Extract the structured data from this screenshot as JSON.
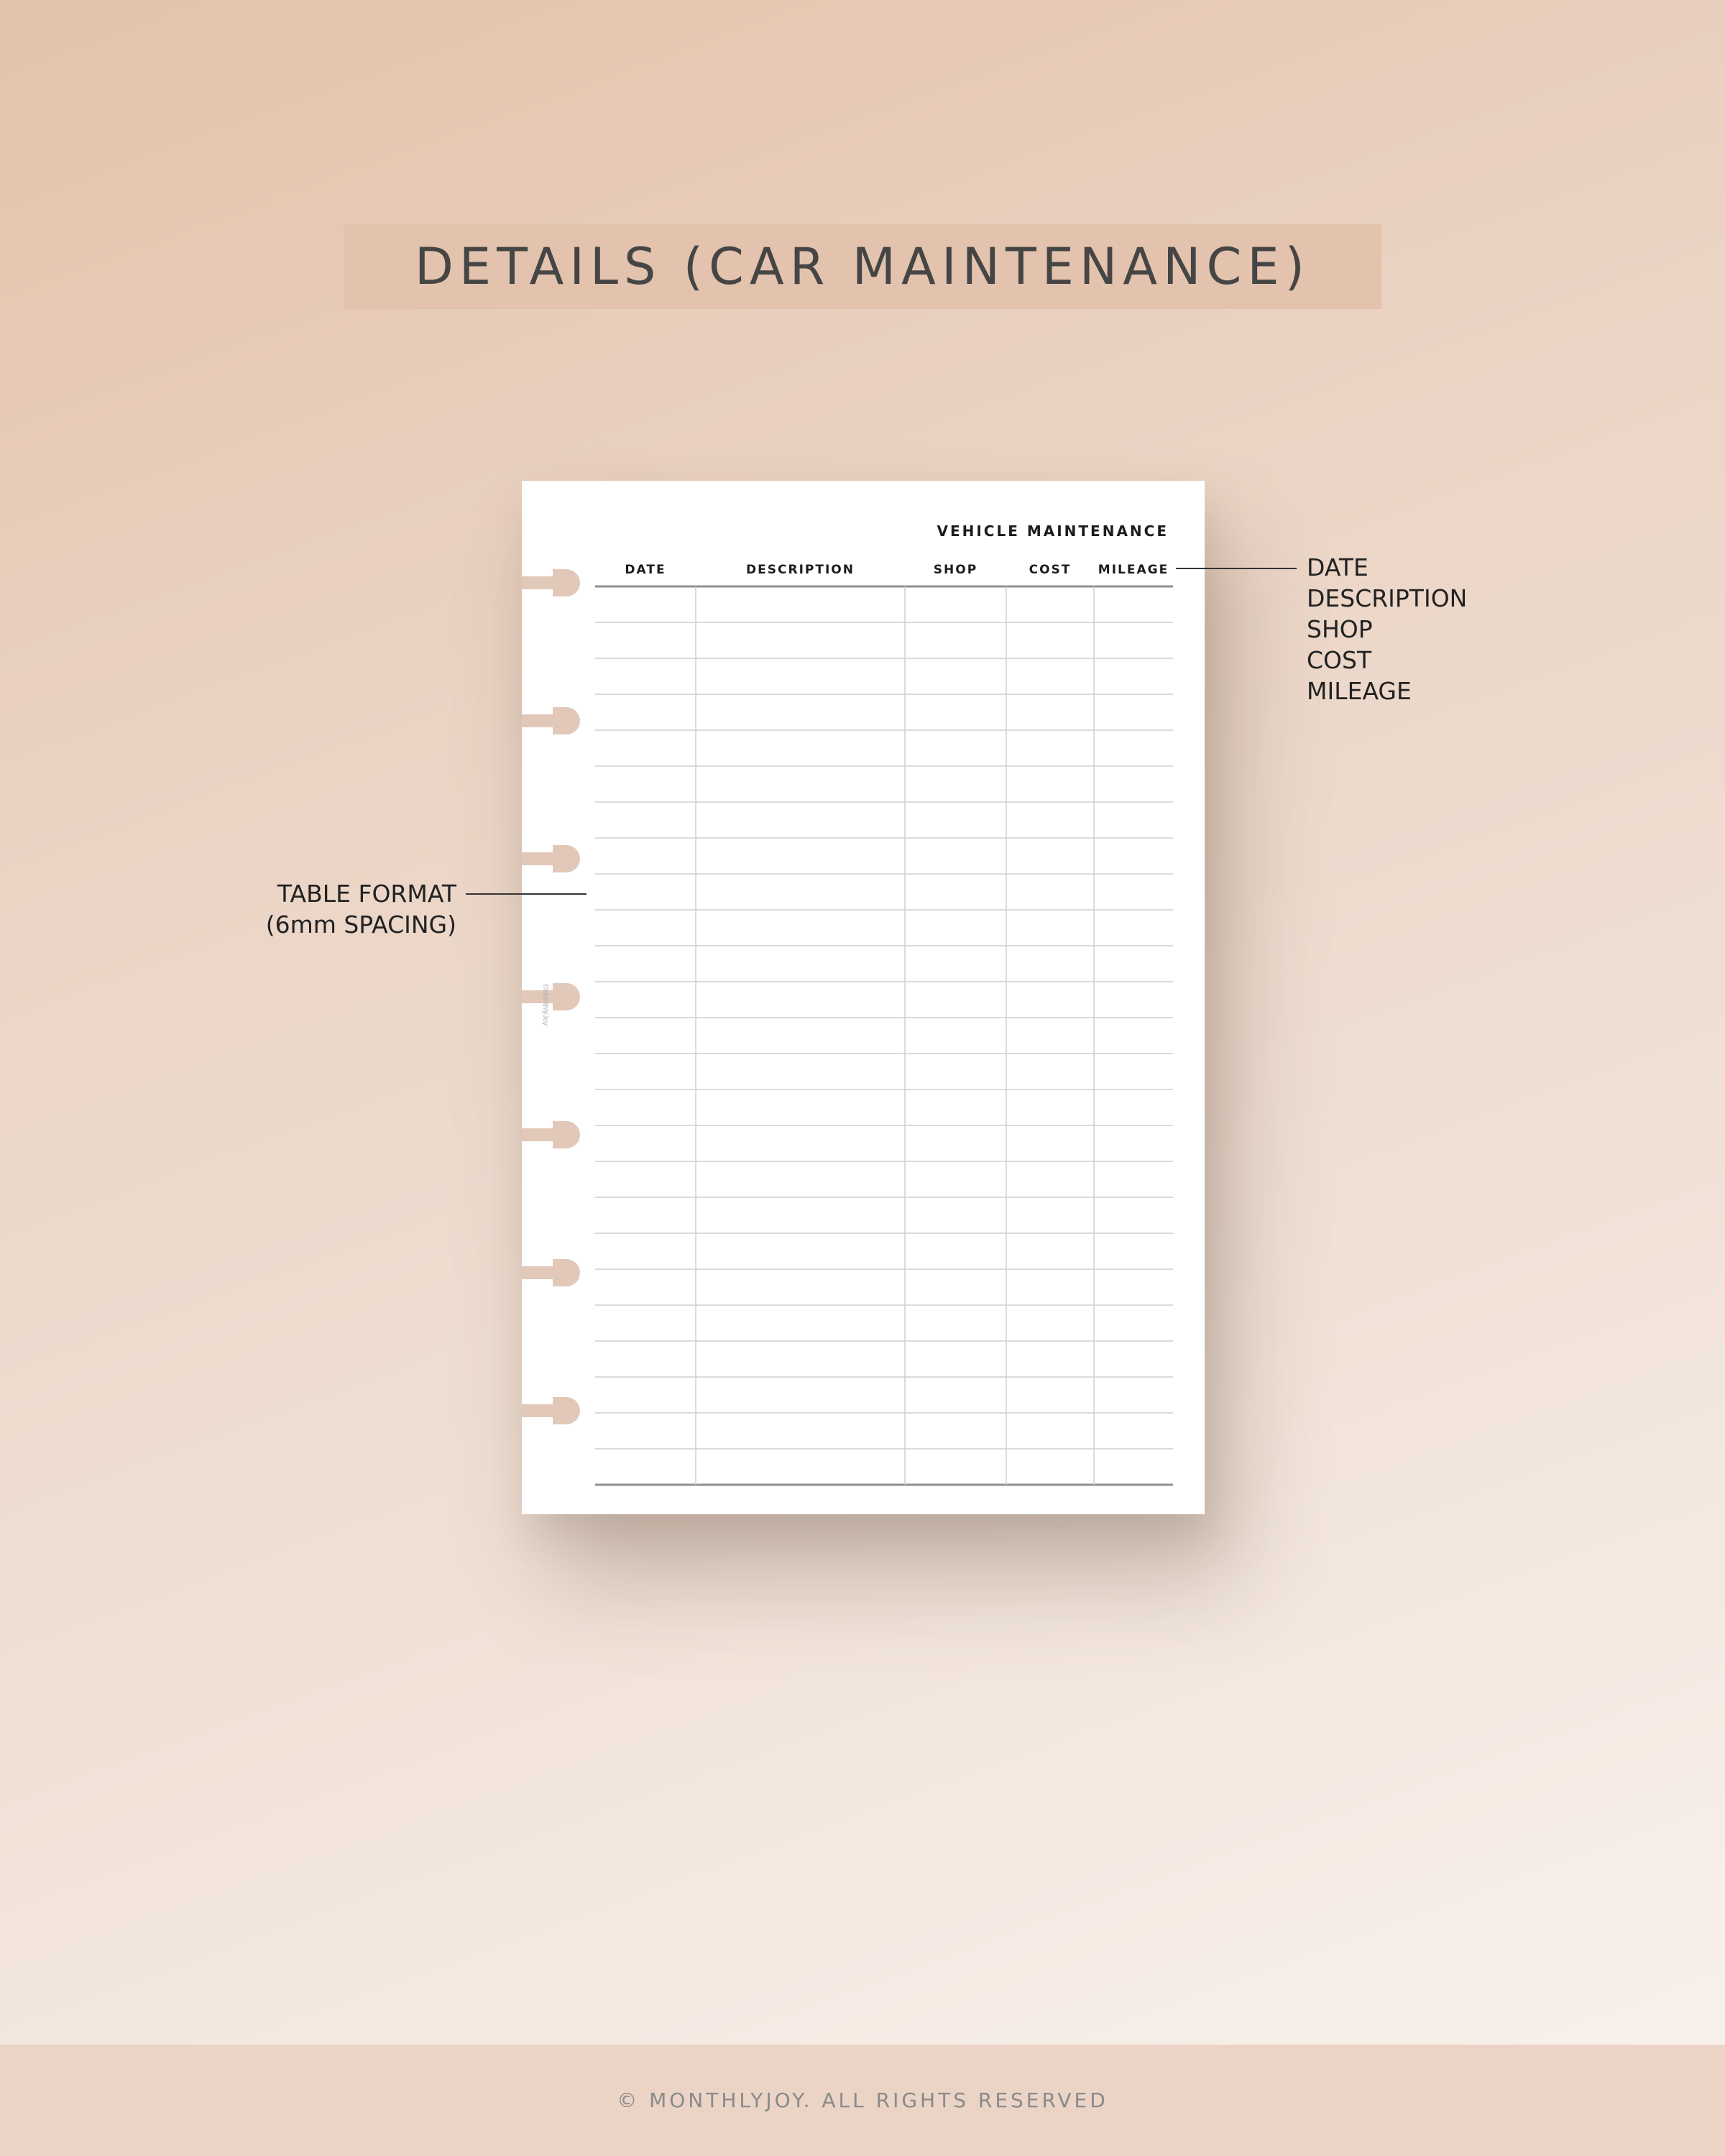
{
  "header": {
    "title": "DETAILS (CAR MAINTENANCE)"
  },
  "sheet": {
    "title": "VEHICLE MAINTENANCE",
    "columns": [
      "DATE",
      "DESCRIPTION",
      "SHOP",
      "COST",
      "MILEAGE"
    ],
    "row_count": 25,
    "side_mark": "©MonthlyJoy",
    "tab_count": 7
  },
  "callouts": {
    "fields": [
      "DATE",
      "DESCRIPTION",
      "SHOP",
      "COST",
      "MILEAGE"
    ],
    "format_line1": "TABLE FORMAT",
    "format_line2": "(6mm SPACING)"
  },
  "footer": {
    "copyright": "© MONTHLYJOY. ALL RIGHTS RESERVED"
  },
  "colors": {
    "band": "#e3c3ad",
    "tab": "#e2c8b8",
    "footer_band": "#ebd4c6"
  }
}
